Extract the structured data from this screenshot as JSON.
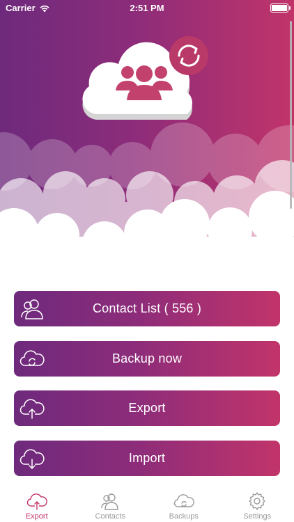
{
  "status_bar": {
    "carrier": "Carrier",
    "time": "2:51 PM"
  },
  "colors": {
    "accent": "#c0346a",
    "gradient_start": "#6e2a7c",
    "gradient_end": "#c1346a",
    "inactive": "#9a9a9a"
  },
  "menu": {
    "contact_list": {
      "label": "Contact List ( 556 )",
      "icon": "contacts-icon"
    },
    "backup": {
      "label": "Backup now",
      "icon": "cloud-sync-icon"
    },
    "export": {
      "label": "Export",
      "icon": "cloud-upload-icon"
    },
    "import": {
      "label": "Import",
      "icon": "cloud-download-icon"
    }
  },
  "tabs": [
    {
      "label": "Export",
      "icon": "cloud-upload-icon",
      "active": true
    },
    {
      "label": "Contacts",
      "icon": "contacts-icon",
      "active": false
    },
    {
      "label": "Backups",
      "icon": "cloud-sync-icon",
      "active": false
    },
    {
      "label": "Settings",
      "icon": "gear-icon",
      "active": false
    }
  ]
}
